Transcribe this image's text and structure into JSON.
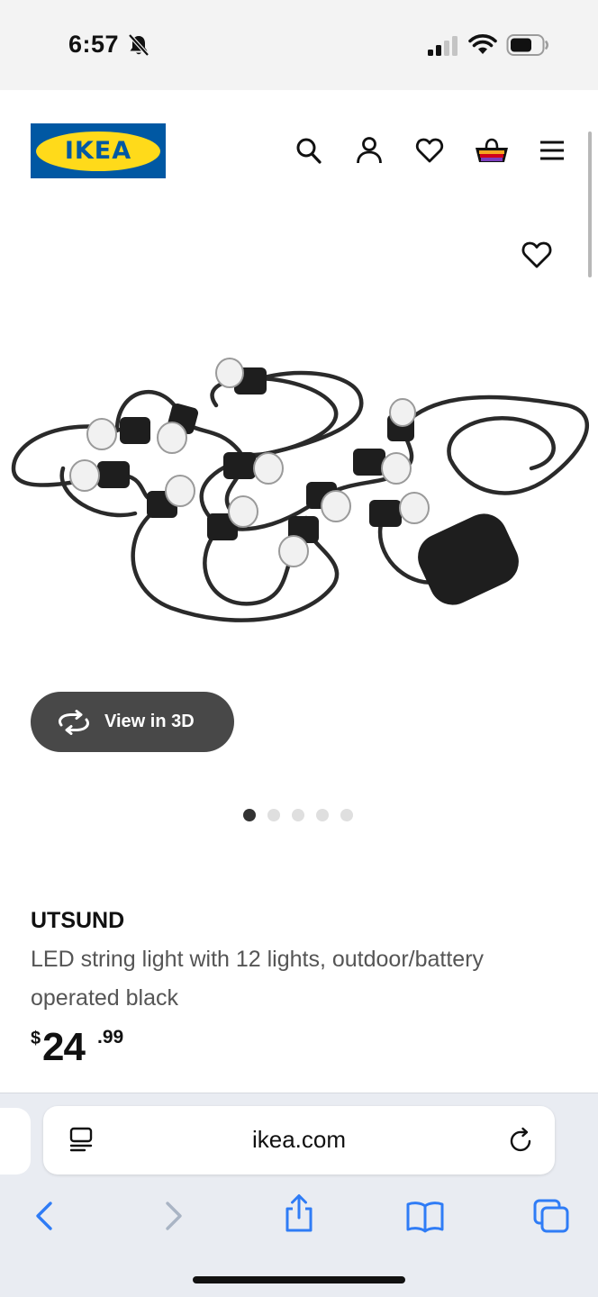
{
  "status_bar": {
    "time": "6:57",
    "icons": [
      "bell-off-icon",
      "signal-icon",
      "wifi-icon",
      "battery-icon"
    ]
  },
  "header": {
    "logo_text": "IKEA",
    "brand_colors": {
      "blue": "#0058a3",
      "yellow": "#ffda1a"
    },
    "icons": [
      "search-icon",
      "account-icon",
      "wishlist-icon",
      "cart-icon",
      "menu-icon"
    ]
  },
  "gallery": {
    "view_3d_label": "View in 3D",
    "dots_total": 5,
    "active_dot": 1
  },
  "product": {
    "name": "UTSUND",
    "description": "LED string light with 12 lights, outdoor/battery operated black",
    "price": {
      "currency": "$",
      "integer": "24",
      "decimal": ".99"
    }
  },
  "browser": {
    "url": "ikea.com",
    "toolbar": [
      "back-icon",
      "forward-icon",
      "share-icon",
      "bookmarks-icon",
      "tabs-icon"
    ]
  }
}
